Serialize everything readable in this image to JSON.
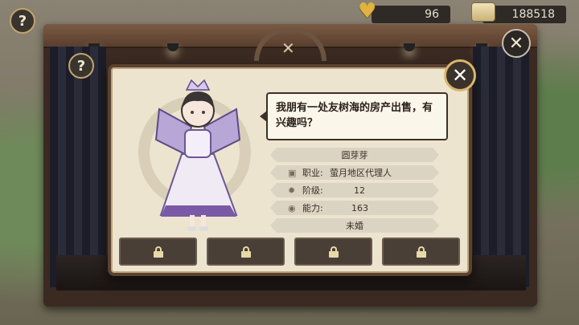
{
  "hud": {
    "hearts": "96",
    "coins": "188518",
    "help_glyph": "?",
    "close_glyph": "✕"
  },
  "dialog": {
    "close_glyph": "✕",
    "speech": "我朋有一处友树海的房产出售，有兴趣吗？",
    "character": {
      "name": "圆芽芽",
      "job_label": "职业:",
      "job_value": "萤月地区代理人",
      "rank_label": "阶级:",
      "rank_value": "12",
      "ability_label": "能力:",
      "ability_value": "163",
      "marital_status": "未婚"
    },
    "slots": [
      {
        "locked": true
      },
      {
        "locked": true
      },
      {
        "locked": true
      },
      {
        "locked": true
      }
    ]
  },
  "icons": {
    "heart": "heart-icon",
    "coin": "coin-stack-icon",
    "job": "briefcase-icon",
    "rank": "gear-icon",
    "ability": "orb-icon",
    "lock": "lock-icon"
  },
  "colors": {
    "panel": "#ede4cf",
    "frame": "#5b4130",
    "accent_gold": "#d9b66c",
    "character_purple": "#7a5aa6"
  }
}
